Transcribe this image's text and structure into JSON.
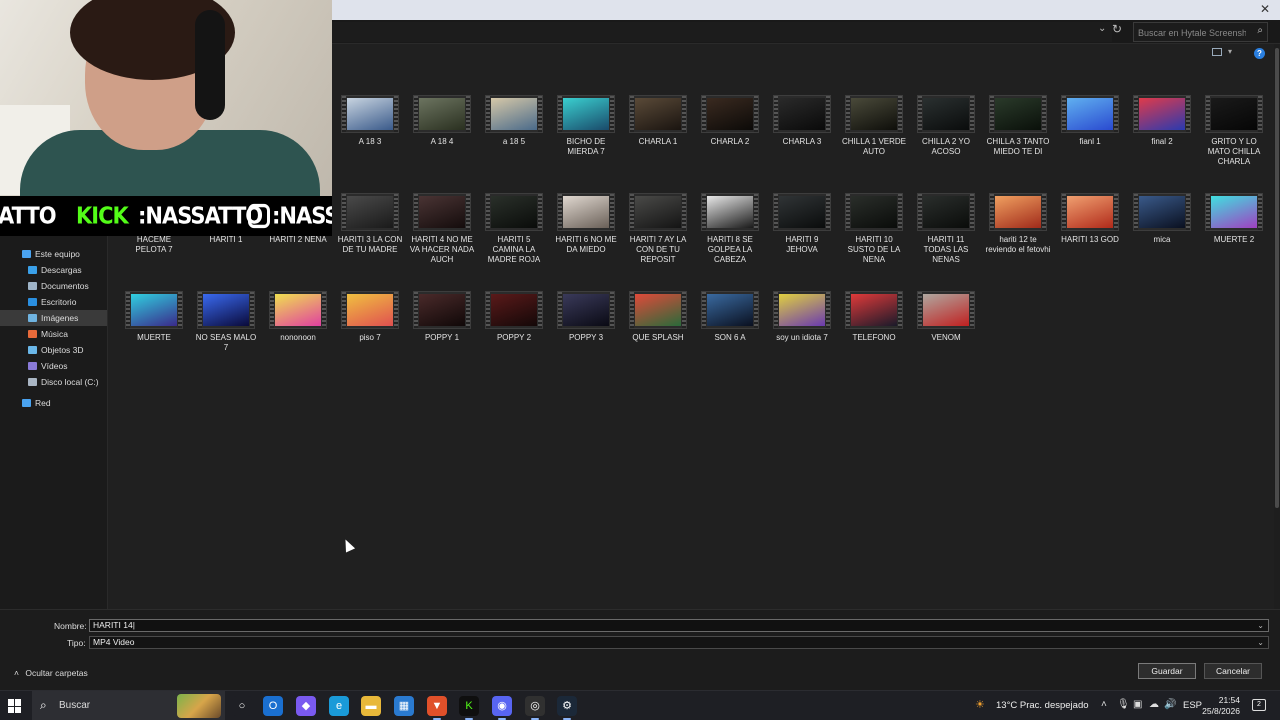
{
  "dialog": {
    "search_placeholder": "Buscar en Hytale Screenshots",
    "close_glyph": "✕",
    "help_glyph": "?"
  },
  "nav": {
    "items": [
      {
        "label": "Este equipo",
        "icon": "pc-icon",
        "color": "#4aa3f0"
      },
      {
        "label": "Descargas",
        "icon": "download-icon",
        "color": "#3aa0e8"
      },
      {
        "label": "Documentos",
        "icon": "documents-icon",
        "color": "#9fb4c8"
      },
      {
        "label": "Escritorio",
        "icon": "desktop-icon",
        "color": "#2a8fe0"
      },
      {
        "label": "Imágenes",
        "icon": "pictures-icon",
        "color": "#6fb3e0"
      },
      {
        "label": "Música",
        "icon": "music-icon",
        "color": "#e86a3a"
      },
      {
        "label": "Objetos 3D",
        "icon": "objects3d-icon",
        "color": "#6ab7e8"
      },
      {
        "label": "Vídeos",
        "icon": "videos-icon",
        "color": "#8a7ad8"
      },
      {
        "label": "Disco local (C:)",
        "icon": "drive-icon",
        "color": "#aab6c4"
      },
      {
        "label": "Red",
        "icon": "network-icon",
        "color": "#4aa3f0"
      }
    ]
  },
  "files": {
    "row1": [
      {
        "name": "A 18 3",
        "thumb": [
          "#c8d4e0",
          "#3a5a8a"
        ]
      },
      {
        "name": "A 18 4",
        "thumb": [
          "#6c7460",
          "#2a3020"
        ]
      },
      {
        "name": "a 18 5",
        "thumb": [
          "#d6c8a8",
          "#4a6a8a"
        ]
      },
      {
        "name": "BICHO DE MIERDA 7",
        "thumb": [
          "#3ad0d0",
          "#1a4a6a"
        ]
      },
      {
        "name": "CHARLA 1",
        "thumb": [
          "#5a4a38",
          "#1a1410"
        ]
      },
      {
        "name": "CHARLA 2",
        "thumb": [
          "#3a2a20",
          "#0c0a08"
        ]
      },
      {
        "name": "CHARLA 3",
        "thumb": [
          "#2a2a2a",
          "#0a0a0a"
        ]
      },
      {
        "name": "CHILLA 1 VERDE AUTO",
        "thumb": [
          "#4a4a3a",
          "#0e0e0a"
        ]
      },
      {
        "name": "CHILLA 2 YO ACOSO",
        "thumb": [
          "#2a3030",
          "#0a0c0c"
        ]
      },
      {
        "name": "CHILLA 3 TANTO MIEDO TE DI",
        "thumb": [
          "#2a3a2a",
          "#0a100a"
        ]
      },
      {
        "name": "fianl 1",
        "thumb": [
          "#60b0f0",
          "#2a4ad0"
        ]
      },
      {
        "name": "final 2",
        "thumb": [
          "#e03a4a",
          "#2a3ab0"
        ]
      },
      {
        "name": "GRITO Y LO MATO CHILLA CHARLA",
        "thumb": [
          "#1a1a1a",
          "#060606"
        ]
      }
    ],
    "row2": [
      {
        "name": "HACEME PELOTA 7",
        "thumb": [
          "#3a3a3a",
          "#101010"
        ]
      },
      {
        "name": "HARITI 1",
        "thumb": [
          "#2a2a2a",
          "#0a0a0a"
        ]
      },
      {
        "name": "HARITI 2 NENA",
        "thumb": [
          "#303030",
          "#0c0c0c"
        ]
      },
      {
        "name": "HARITI 3 LA CON DE TU MADRE",
        "thumb": [
          "#4a4a4a",
          "#1a1a1a"
        ]
      },
      {
        "name": "HARITI 4 NO ME VA HACER NADA AUCH",
        "thumb": [
          "#4a3434",
          "#140c0c"
        ]
      },
      {
        "name": "HARITI 5 CAMINA LA MADRE ROJA",
        "thumb": [
          "#2a302a",
          "#0a0c0a"
        ]
      },
      {
        "name": "HARITI 6 NO ME DA MIEDO",
        "thumb": [
          "#e0d8d0",
          "#6a6058"
        ]
      },
      {
        "name": "HARITI 7 AY LA CON DE TU REPOSIT",
        "thumb": [
          "#4a4a48",
          "#141414"
        ]
      },
      {
        "name": "HARITI 8 SE GOLPEA LA CABEZA",
        "thumb": [
          "#e8e8e8",
          "#1a1a1a"
        ]
      },
      {
        "name": "HARITI 9 JEHOVA",
        "thumb": [
          "#303436",
          "#0a0c0c"
        ]
      },
      {
        "name": "HARITI 10 SUSTO DE LA NENA",
        "thumb": [
          "#2a2e2a",
          "#0a0c0a"
        ]
      },
      {
        "name": "HARITI 11 TODAS LAS NENAS",
        "thumb": [
          "#2a2e2c",
          "#0a0c0a"
        ]
      },
      {
        "name": "hariti 12 te reviendo el fetovhi",
        "thumb": [
          "#f0a060",
          "#a02a1a"
        ]
      },
      {
        "name": "HARITI 13 GOD",
        "thumb": [
          "#f0a070",
          "#b02a1a"
        ]
      },
      {
        "name": "mica",
        "thumb": [
          "#3a5a8a",
          "#0a1020"
        ]
      },
      {
        "name": "MUERTE 2",
        "thumb": [
          "#40e0e0",
          "#a040c0"
        ]
      }
    ],
    "row3": [
      {
        "name": "MUERTE",
        "thumb": [
          "#30d0e0",
          "#3a2a8a"
        ]
      },
      {
        "name": "NO SEAS MALO 7",
        "thumb": [
          "#3a6af0",
          "#0a0a3a"
        ]
      },
      {
        "name": "nononoon",
        "thumb": [
          "#f0e050",
          "#e040a0"
        ]
      },
      {
        "name": "piso 7",
        "thumb": [
          "#f0c040",
          "#e05050"
        ]
      },
      {
        "name": "POPPY 1",
        "thumb": [
          "#4a2a2a",
          "#100808"
        ]
      },
      {
        "name": "POPPY 2",
        "thumb": [
          "#5a1a1a",
          "#140808"
        ]
      },
      {
        "name": "POPPY 3",
        "thumb": [
          "#3a3a5a",
          "#0a0a14"
        ]
      },
      {
        "name": "QUE SPLASH",
        "thumb": [
          "#e04a3a",
          "#2a6a3a"
        ]
      },
      {
        "name": "SON 6 A",
        "thumb": [
          "#3a6aa0",
          "#0a1020"
        ]
      },
      {
        "name": "soy un idiota 7",
        "thumb": [
          "#e0d040",
          "#6a3ab0"
        ]
      },
      {
        "name": "TELEFONO",
        "thumb": [
          "#e03a3a",
          "#1a1a2a"
        ]
      },
      {
        "name": "VENOM",
        "thumb": [
          "#b0a8a0",
          "#c02020"
        ]
      }
    ]
  },
  "form": {
    "name_label": "Nombre:",
    "name_value": "HARITI 14",
    "type_label": "Tipo:",
    "type_value": "MP4 Video",
    "hide_folders": "Ocultar carpetas",
    "save": "Guardar",
    "cancel": "Cancelar"
  },
  "overlay": {
    "social_prefix": "ATTO",
    "kick_brand": "KICK",
    "kick_handle": ":NASSATTO",
    "ig_handle": ":NASS"
  },
  "taskbar": {
    "search_label": "Buscar",
    "weather": "13°C  Prac. despejado",
    "lang": "ESP",
    "time": "21:54",
    "date": "25/8/2026",
    "notif_count": "2",
    "apps": [
      "task-view-icon",
      "outlook-icon",
      "copilot-icon",
      "edge-icon",
      "file-explorer-icon",
      "store-icon",
      "brave-icon",
      "kick-app-icon",
      "discord-icon",
      "obs-icon",
      "steam-icon"
    ]
  }
}
